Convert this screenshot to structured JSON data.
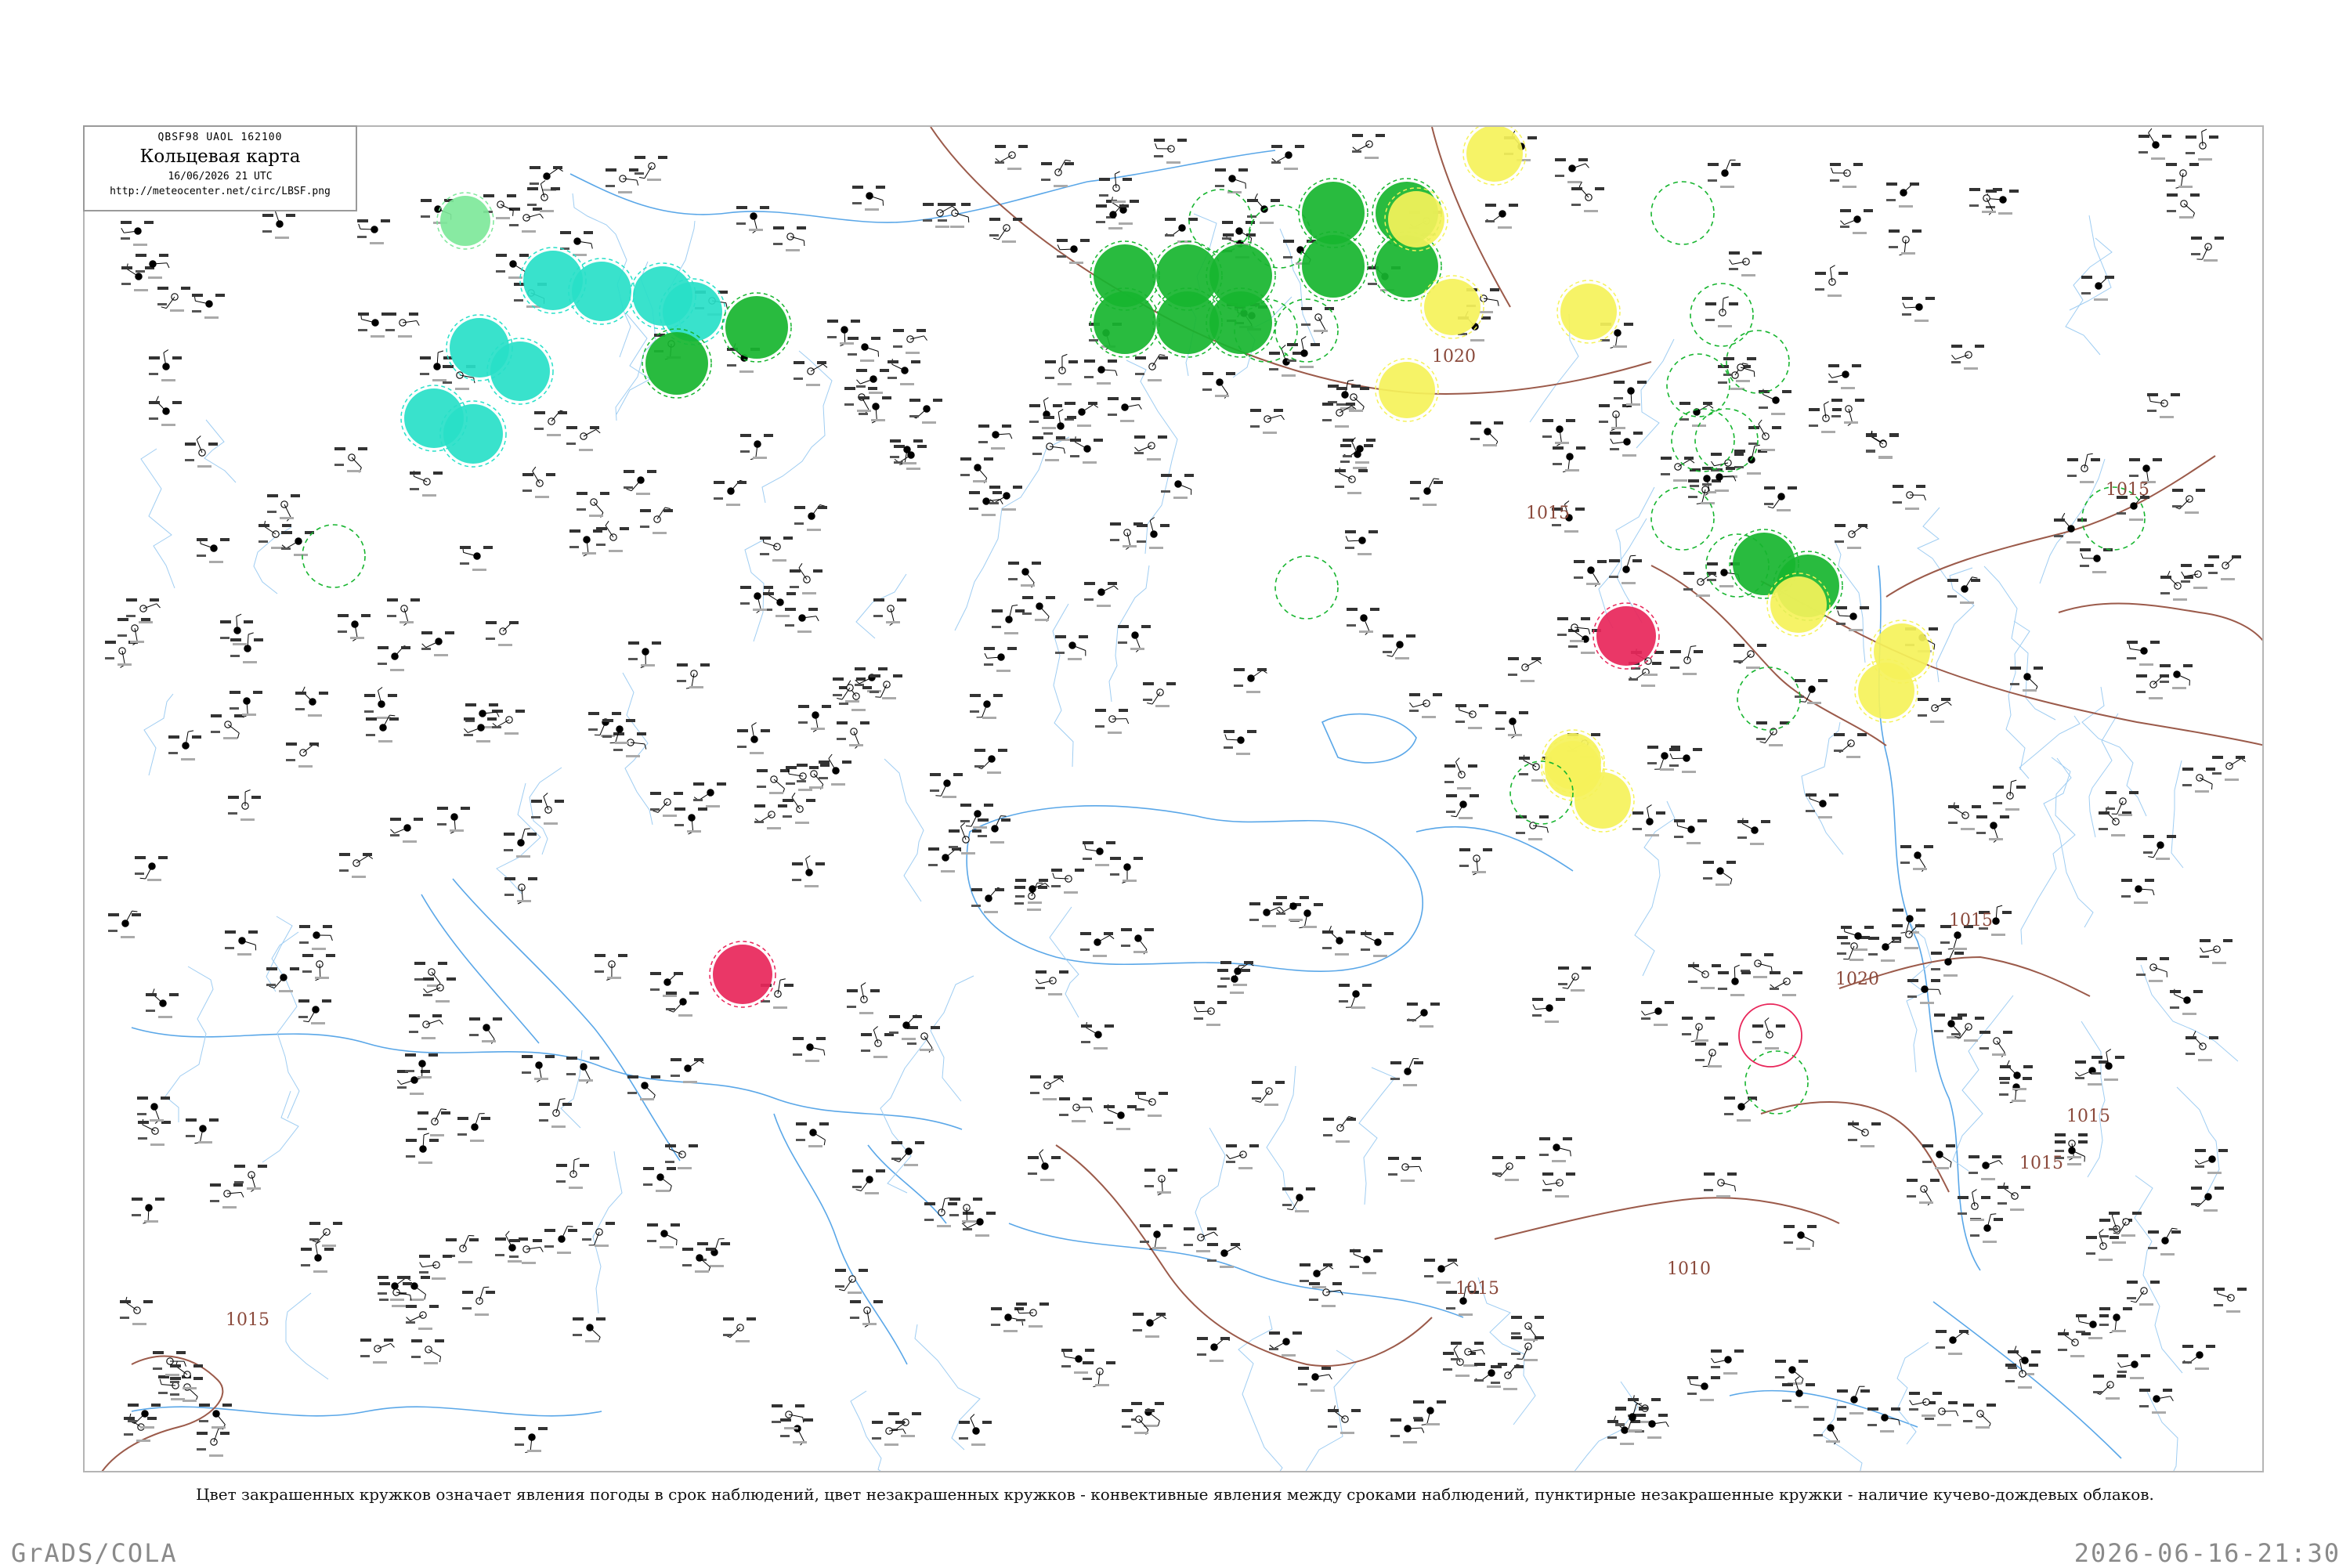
{
  "header": {
    "code": "QBSF98  UAOL  162100",
    "title": "Кольцевая карта",
    "datetime": "16/06/2026 21 UTC",
    "url": "http://meteocenter.net/circ/LBSF.png"
  },
  "map": {
    "isobars": [
      "1015",
      "1015",
      "1015",
      "1015",
      "1020",
      "1020",
      "1015",
      "1015",
      "1010",
      "1015"
    ],
    "colors": {
      "coast": "#5aa7e8",
      "isobar": "#9b5a4a",
      "green": "#17b52f",
      "green_dark": "#0a9a22",
      "cyan": "#28e0c8",
      "yellow": "#f5f25a",
      "red": "#e8265a",
      "mint": "#7ee89a"
    }
  },
  "legend": {
    "caption": "Цвет закрашенных кружков означает явления погоды в срок наблюдений, цвет незакрашенных кружков - конвективные явления между сроками наблюдений, пунктирные незакрашенные кружки - наличие кучево-дождевых облаков."
  },
  "footer": {
    "left": "GrADS/COLA",
    "right": "2026-06-16-21:30"
  }
}
